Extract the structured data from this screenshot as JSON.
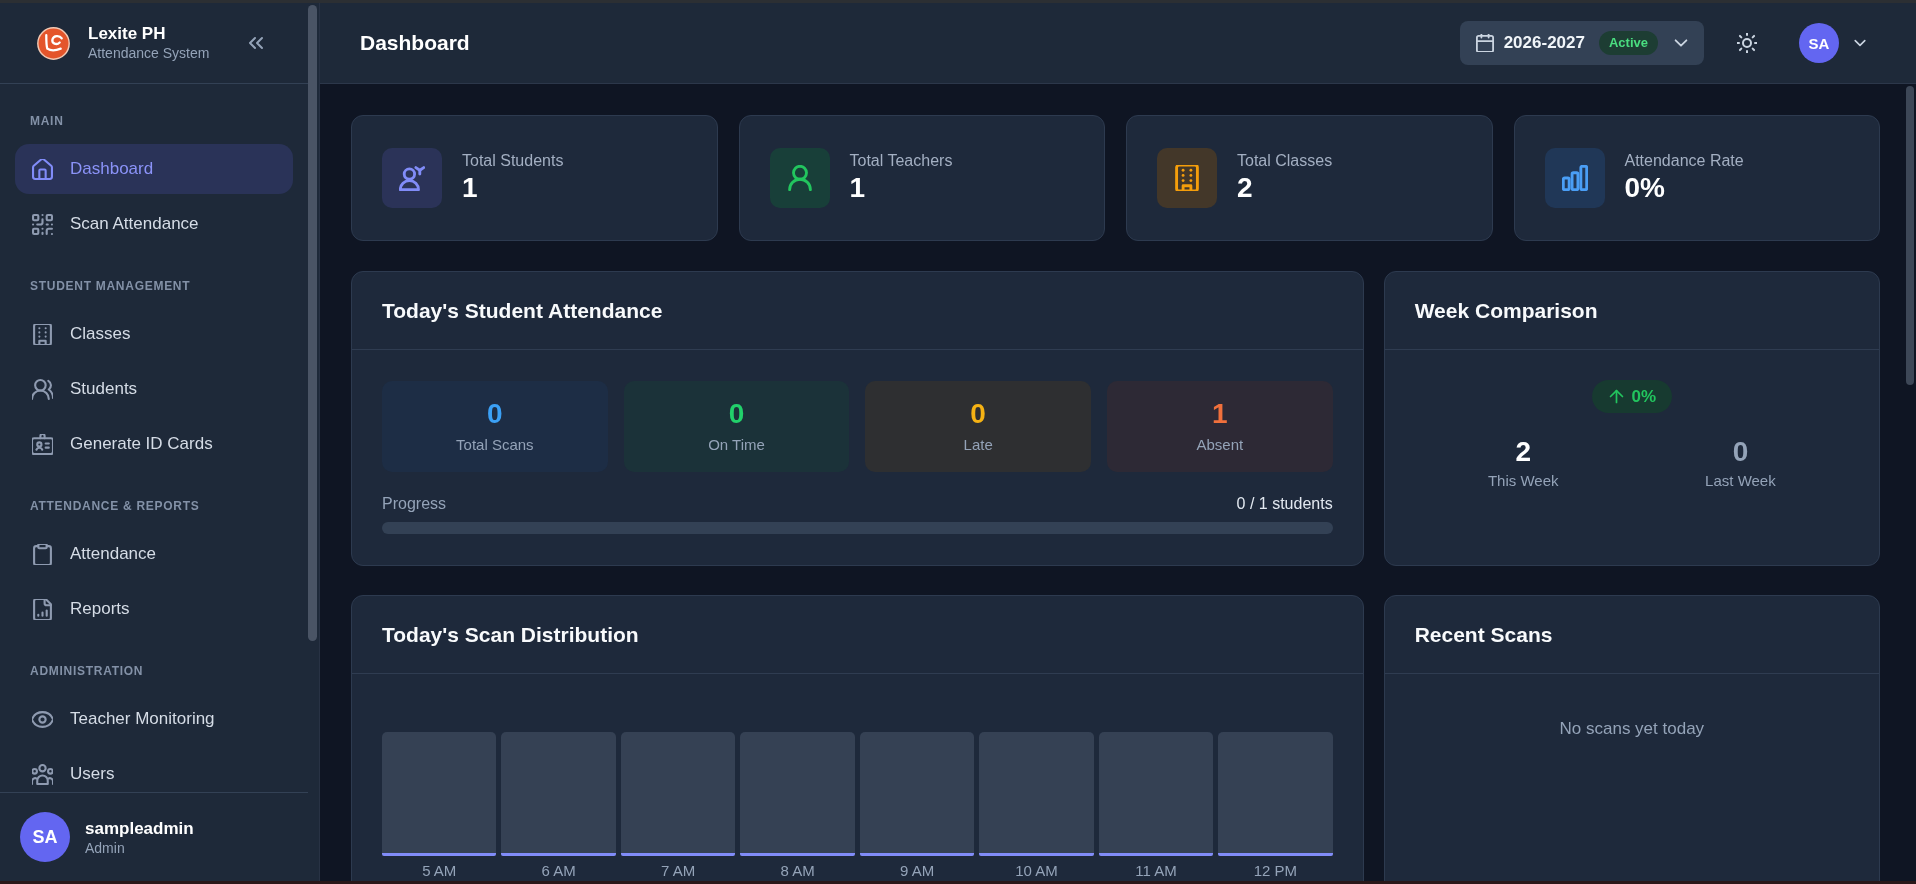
{
  "sidebar": {
    "brand": {
      "name": "Lexite PH",
      "subtitle": "Attendance System"
    },
    "sections": [
      {
        "title": "MAIN",
        "items": [
          {
            "label": "Dashboard",
            "selected": true
          },
          {
            "label": "Scan Attendance",
            "selected": false
          }
        ]
      },
      {
        "title": "STUDENT MANAGEMENT",
        "items": [
          {
            "label": "Classes",
            "selected": false
          },
          {
            "label": "Students",
            "selected": false
          },
          {
            "label": "Generate ID Cards",
            "selected": false
          }
        ]
      },
      {
        "title": "ATTENDANCE & REPORTS",
        "items": [
          {
            "label": "Attendance",
            "selected": false
          },
          {
            "label": "Reports",
            "selected": false
          }
        ]
      },
      {
        "title": "ADMINISTRATION",
        "items": [
          {
            "label": "Teacher Monitoring",
            "selected": false
          },
          {
            "label": "Users",
            "selected": false
          }
        ]
      }
    ],
    "user": {
      "initials": "SA",
      "name": "sampleadmin",
      "role": "Admin"
    }
  },
  "header": {
    "title": "Dashboard",
    "school_year": {
      "label": "2026-2027",
      "status": "Active"
    },
    "user_initials": "SA"
  },
  "stats": [
    {
      "label": "Total Students",
      "value": "1",
      "color": "#818cf8"
    },
    {
      "label": "Total Teachers",
      "value": "1",
      "color": "#22c55e"
    },
    {
      "label": "Total Classes",
      "value": "2",
      "color": "#f59e0b"
    },
    {
      "label": "Attendance Rate",
      "value": "0%",
      "color": "#4a9ef5"
    }
  ],
  "todays_attendance": {
    "title": "Today's Student Attendance",
    "summary": [
      {
        "value": "0",
        "label": "Total Scans",
        "color": "#3ba0f5"
      },
      {
        "value": "0",
        "label": "On Time",
        "color": "#22d16b"
      },
      {
        "value": "0",
        "label": "Late",
        "color": "#f5b214"
      },
      {
        "value": "1",
        "label": "Absent",
        "color": "#f0703c"
      }
    ],
    "progress": {
      "label": "Progress",
      "reading": "0 / 1 students",
      "level": 0
    }
  },
  "week_comparison": {
    "title": "Week Comparison",
    "change": {
      "value": "0%",
      "increase": true
    },
    "periods": [
      {
        "value": "2",
        "label": "This Week"
      },
      {
        "value": "0",
        "label": "Last Week"
      }
    ]
  },
  "scan_distribution": {
    "title": "Today's Scan Distribution",
    "hours": [
      "5 AM",
      "6 AM",
      "7 AM",
      "8 AM",
      "9 AM",
      "10 AM",
      "11 AM",
      "12 PM"
    ]
  },
  "recent_scans": {
    "title": "Recent Scans",
    "empty_message": "No scans yet today"
  }
}
